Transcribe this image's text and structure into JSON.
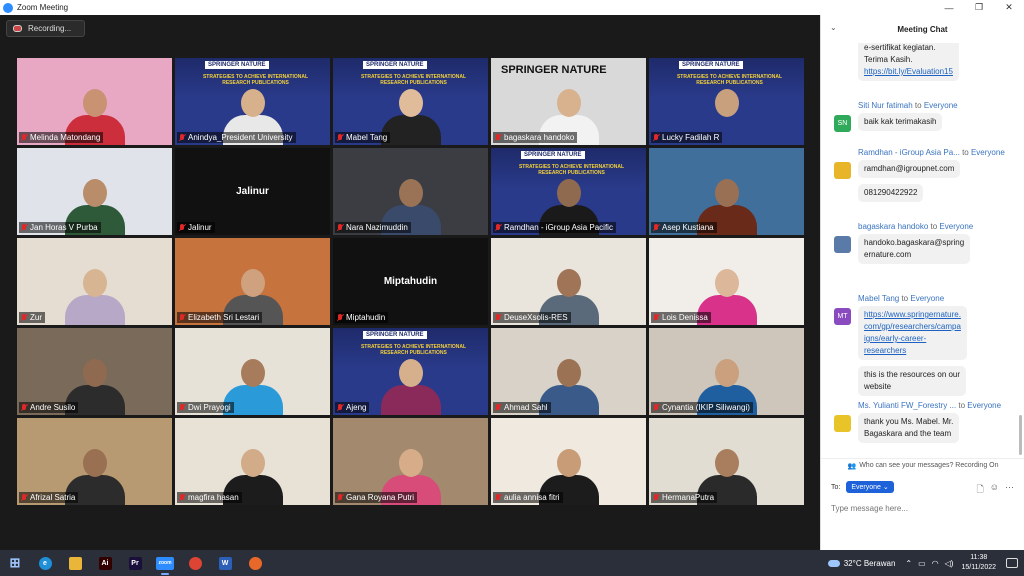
{
  "window": {
    "title": "Zoom Meeting",
    "controls": [
      "—",
      "❐",
      "✕"
    ]
  },
  "recording": {
    "label": "Recording..."
  },
  "tiles": [
    {
      "name": "Melinda Matondang",
      "bg": "#e8a8c4",
      "skin": "#c99273",
      "shirt": "#cc2e3c",
      "type": "photo"
    },
    {
      "name": "Anindya_President University",
      "bg": "#2a3a8a",
      "skin": "#d7b08c",
      "shirt": "#e8e8e8",
      "type": "banner",
      "active": true
    },
    {
      "name": "Mabel Tang",
      "bg": "#2a3a8a",
      "skin": "#e0bc9a",
      "shirt": "#222222",
      "type": "banner"
    },
    {
      "name": "bagaskara handoko",
      "bg": "#d9d9d9",
      "skin": "#d8b28e",
      "shirt": "#f2f2f2",
      "type": "springer"
    },
    {
      "name": "Lucky Fadilah R",
      "bg": "#2a3a8a",
      "skin": "#c8a07e",
      "shirt": "#2a3a8a",
      "type": "banner"
    },
    {
      "name": "Jan Horas V Purba",
      "bg": "#e0e4ea",
      "skin": "#b98c6a",
      "shirt": "#2f5a3a",
      "type": "photo"
    },
    {
      "name": "Jalinur",
      "display": "Jalinur",
      "type": "name"
    },
    {
      "name": "Nara Nazimuddin",
      "bg": "#3b3d42",
      "skin": "#9a7356",
      "shirt": "#3a4a6a",
      "type": "photo"
    },
    {
      "name": "Ramdhan - iGroup Asia Pacific",
      "bg": "#2a3a8a",
      "skin": "#8f6a4e",
      "shirt": "#1a1a1a",
      "type": "banner"
    },
    {
      "name": "Asep Kustiana",
      "bg": "#3f6f9a",
      "skin": "#9a7054",
      "shirt": "#6a2a1a",
      "type": "photo"
    },
    {
      "name": "Zur",
      "bg": "#e6ddd2",
      "skin": "#d8b592",
      "shirt": "#b8a8c8",
      "type": "photo"
    },
    {
      "name": "Elizabeth Sri Lestari",
      "bg": "#c7733e",
      "skin": "#cfa17f",
      "shirt": "#555555",
      "type": "photo"
    },
    {
      "name": "Miptahudin",
      "display": "Miptahudin",
      "type": "name"
    },
    {
      "name": "DeuseXsolis-RES",
      "bg": "#e9e4dc",
      "skin": "#9f7457",
      "shirt": "#5a6a7a",
      "type": "photo"
    },
    {
      "name": "Lois Denissa",
      "bg": "#f1eee9",
      "skin": "#dcb79a",
      "shirt": "#d8328a",
      "type": "photo"
    },
    {
      "name": "Andre Susilo",
      "bg": "#7a6a5a",
      "skin": "#8f6a50",
      "shirt": "#2c2c2c",
      "type": "photo"
    },
    {
      "name": "Dwi Prayogi",
      "bg": "#e7e2d8",
      "skin": "#a77c5c",
      "shirt": "#2a9ad8",
      "type": "photo"
    },
    {
      "name": "Ajeng",
      "bg": "#2a3a8a",
      "skin": "#d6b08c",
      "shirt": "#8a2a5a",
      "type": "banner"
    },
    {
      "name": "Ahmad Sahl",
      "bg": "#d8d2c8",
      "skin": "#9c7254",
      "shirt": "#3a5a8a",
      "type": "photo"
    },
    {
      "name": "Cynantia (IKIP Siliwangi)",
      "bg": "#cfc6bb",
      "skin": "#caa07e",
      "shirt": "#1f5f9f",
      "type": "photo"
    },
    {
      "name": "Afrizal Satria",
      "bg": "#b89a72",
      "skin": "#9a7052",
      "shirt": "#2c2c2c",
      "type": "photo"
    },
    {
      "name": "magfira hasan",
      "bg": "#e7e1d6",
      "skin": "#d2ab88",
      "shirt": "#1c1c1c",
      "type": "photo"
    },
    {
      "name": "Gana Royana Putri",
      "bg": "#a38a6e",
      "skin": "#d6ad88",
      "shirt": "#d84c7a",
      "type": "photo"
    },
    {
      "name": "aulia annisa fitri",
      "bg": "#efe9df",
      "skin": "#c99c78",
      "shirt": "#1c1c1c",
      "type": "photo"
    },
    {
      "name": "HermanaPutra",
      "bg": "#e2ddd3",
      "skin": "#a87e5e",
      "shirt": "#2a2a2a",
      "type": "photo"
    }
  ],
  "banner": {
    "brand": "SPRINGER NATURE",
    "headline": "STRATEGIES TO ACHIEVE INTERNATIONAL RESEARCH PUBLICATIONS"
  },
  "chat": {
    "title": "Meeting Chat",
    "messages": [
      {
        "lines": [
          "e-sertifikat kegiatan.",
          "Terima Kasih.",
          "https://bit.ly/Evaluation15"
        ],
        "link_index": 2
      },
      {
        "sender": "Siti Nur fatimah",
        "to": "to",
        "recipient": "Everyone",
        "initials": "SN",
        "avatar_color": "#2faa5a",
        "lines": [
          "baik kak terimakasih"
        ]
      },
      {
        "sender": "Ramdhan - iGroup Asia Pa...",
        "to": "to",
        "recipient": "Everyone",
        "initials": "",
        "avatar_color": "#e8b428",
        "lines": [
          "ramdhan@igroupnet.com"
        ],
        "extra": "081290422922"
      },
      {
        "sender": "bagaskara handoko",
        "to": "to",
        "recipient": "Everyone",
        "initials": "",
        "avatar_color": "#5a7aa8",
        "lines": [
          "handoko.bagaskara@spring",
          "ernature.com"
        ]
      },
      {
        "sender": "Mabel Tang",
        "to": "to",
        "recipient": "Everyone",
        "initials": "MT",
        "avatar_color": "#8a4ac0",
        "lines": [
          "https://www.springernature.",
          "com/gp/researchers/campa",
          "igns/early-career-",
          "researchers"
        ],
        "all_link": true,
        "extra_lines": [
          "this is the resources on our",
          "website"
        ]
      },
      {
        "sender": "Ms. Yulianti FW_Forestry ...",
        "to": "to",
        "recipient": "Everyone",
        "initials": "",
        "avatar_color": "#e8c428",
        "lines": [
          "thank you Ms. Mabel. Mr.",
          "Bagaskara and the team"
        ]
      }
    ],
    "privacy": "Who can see your messages? Recording On",
    "to_label": "To:",
    "recipient_select": "Everyone",
    "placeholder": "Type message here..."
  },
  "taskbar": {
    "apps": [
      {
        "name": "windows-start-icon",
        "glyph": "⊞",
        "color": "transparent"
      },
      {
        "name": "edge-icon",
        "glyph": "e",
        "color": "#1f8fd8"
      },
      {
        "name": "file-explorer-icon",
        "glyph": "",
        "color": "#e9b63a"
      },
      {
        "name": "illustrator-icon",
        "glyph": "Ai",
        "color": "#330000"
      },
      {
        "name": "premiere-icon",
        "glyph": "Pr",
        "color": "#1a0f3a"
      },
      {
        "name": "zoom-icon",
        "glyph": "zoom",
        "color": "#2d8cff",
        "active": true
      },
      {
        "name": "chrome-icon",
        "glyph": "",
        "color": "#dd4433"
      },
      {
        "name": "word-icon",
        "glyph": "W",
        "color": "#2b5fb8"
      },
      {
        "name": "firefox-icon",
        "glyph": "",
        "color": "#e8682a"
      }
    ],
    "weather": "32°C Berawan",
    "time": "11:38",
    "date": "15/11/2022"
  }
}
